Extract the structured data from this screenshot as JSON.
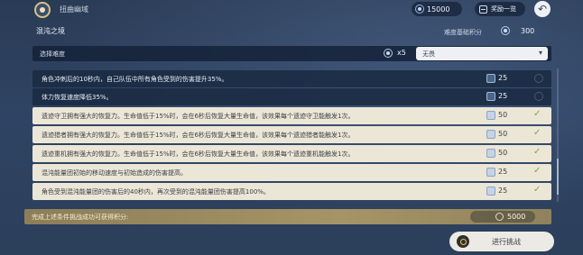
{
  "header": {
    "title": "扭曲幽域",
    "resource_value": "15000",
    "rewards_label": "奖励一览"
  },
  "section": {
    "title": "混沌之境",
    "base_score_label": "难度基础积分",
    "base_score_value": "300"
  },
  "difficulty": {
    "label": "选择难度",
    "multiplier": "x5",
    "selected": "无畏"
  },
  "challenges": [
    {
      "text": "角色冲刺后的10秒内，自己队伍中所有角色受到的伤害提升35%。",
      "points": "25",
      "checked": false
    },
    {
      "text": "体力恢复速度降低35%。",
      "points": "25",
      "checked": false
    },
    {
      "text": "遗迹守卫拥有强大的恢复力。生命值低于15%时，会在6秒后恢复大量生命值，该效果每个遗迹守卫能触发1次。",
      "points": "50",
      "checked": true
    },
    {
      "text": "遗迹猎者拥有强大的恢复力。生命值低于15%时，会在6秒后恢复大量生命值，该效果每个遗迹猎者能触发1次。",
      "points": "50",
      "checked": true
    },
    {
      "text": "遗迹重机拥有强大的恢复力。生命值低于15%时，会在6秒后恢复大量生命值，该效果每个遗迹重机能触发1次。",
      "points": "50",
      "checked": true
    },
    {
      "text": "混沌能量团初始的移动速度与初始造成的伤害提高。",
      "points": "25",
      "checked": true
    },
    {
      "text": "角色受到混沌能量团的伤害后的40秒内，再次受到的混沌能量团伤害提高100%。",
      "points": "25",
      "checked": true
    }
  ],
  "summary": {
    "label": "完成上述条件挑战成功可获得积分:",
    "value": "5000"
  },
  "start_button": {
    "label": "进行挑战"
  }
}
